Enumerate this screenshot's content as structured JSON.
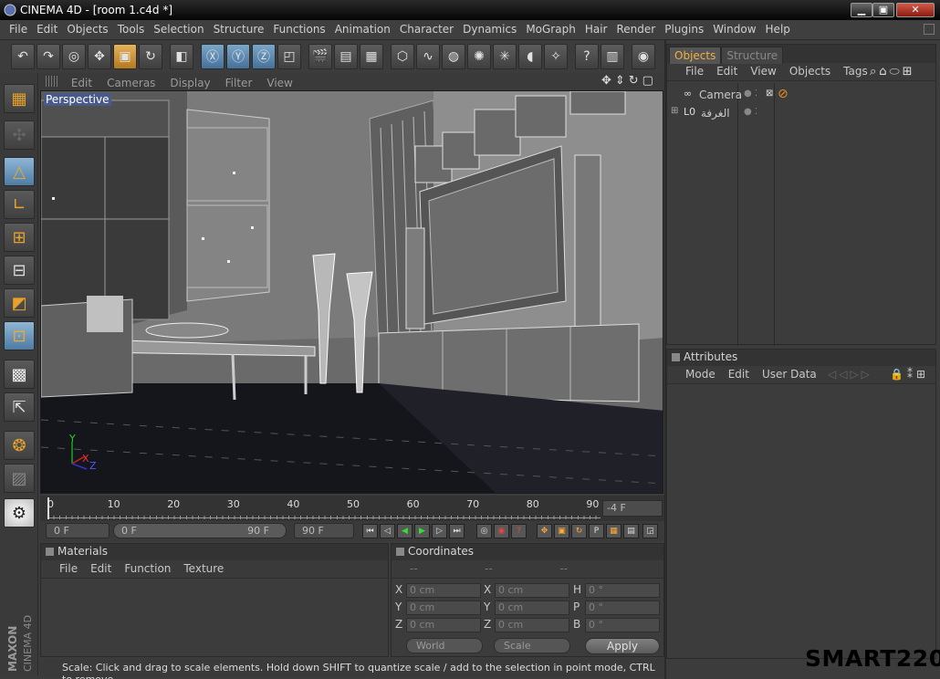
{
  "window": {
    "title": "CINEMA 4D - [room 1.c4d *]",
    "min": "▁",
    "max": "▣",
    "close": "✕"
  },
  "menu": [
    "File",
    "Edit",
    "Objects",
    "Tools",
    "Selection",
    "Structure",
    "Functions",
    "Animation",
    "Character",
    "Dynamics",
    "MoGraph",
    "Hair",
    "Render",
    "Plugins",
    "Window",
    "Help"
  ],
  "viewport": {
    "menu": [
      "Edit",
      "Cameras",
      "Display",
      "Filter",
      "View"
    ],
    "label": "Perspective",
    "axis": {
      "y": "Y",
      "x": "X",
      "z": "Z"
    }
  },
  "timeline": {
    "ticks": [
      "0",
      "10",
      "20",
      "30",
      "40",
      "50",
      "60",
      "70",
      "80",
      "90"
    ],
    "current_frame": "-4 F"
  },
  "transport": {
    "start": "0 F",
    "range_start": "0 F",
    "range_end": "90 F",
    "end": "90 F"
  },
  "materials": {
    "title": "Materials",
    "menu": [
      "File",
      "Edit",
      "Function",
      "Texture"
    ]
  },
  "coordinates": {
    "title": "Coordinates",
    "header": [
      "--",
      "--",
      "--"
    ],
    "rows": [
      {
        "a": "X",
        "av": "0 cm",
        "b": "X",
        "bv": "0 cm",
        "c": "H",
        "cv": "0 °"
      },
      {
        "a": "Y",
        "av": "0 cm",
        "b": "Y",
        "bv": "0 cm",
        "c": "P",
        "cv": "0 °"
      },
      {
        "a": "Z",
        "av": "0 cm",
        "b": "Z",
        "bv": "0 cm",
        "c": "B",
        "cv": "0 °"
      }
    ],
    "space": "World",
    "mode": "Scale",
    "apply": "Apply"
  },
  "status": "Scale: Click and drag to scale elements. Hold down SHIFT to quantize scale / add to the selection in point mode, CTRL to remove.",
  "objects_panel": {
    "tabs": [
      "Objects",
      "Structure"
    ],
    "menu": [
      "File",
      "Edit",
      "View",
      "Objects",
      "Tags"
    ],
    "items": [
      {
        "name": "Camera"
      },
      {
        "name": "الغرفة"
      }
    ]
  },
  "attributes": {
    "title": "Attributes",
    "menu": [
      "Mode",
      "Edit",
      "User Data"
    ]
  },
  "branding": {
    "side_logo": "MAXON CINEMA 4D",
    "watermark": "SMART220"
  },
  "colors": {
    "accent": "#f0b040",
    "viewport_bg": "#6a6a6a",
    "floor": "#15151c"
  }
}
